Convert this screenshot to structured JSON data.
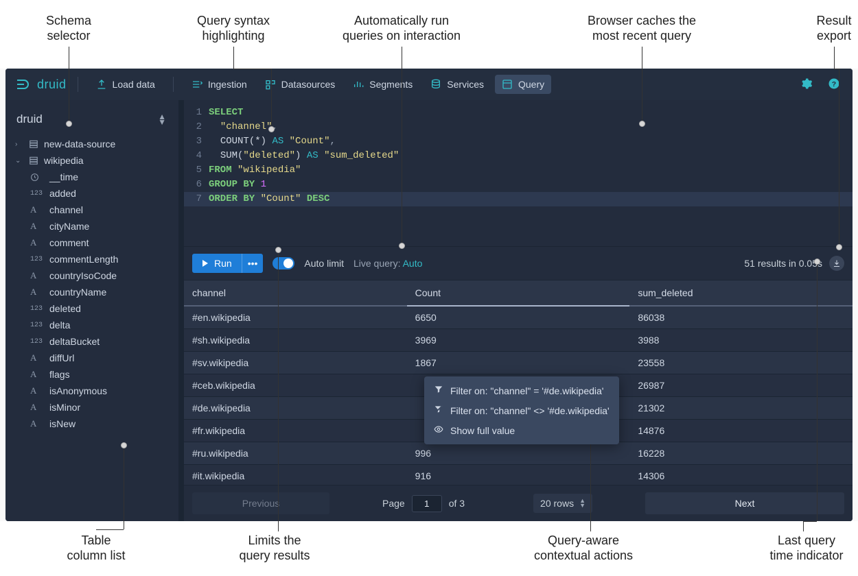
{
  "annotations": {
    "top": [
      "Schema\nselector",
      "Query syntax\nhighlighting",
      "Automatically run\nqueries on interaction",
      "Browser caches the\nmost recent query",
      "Result\nexport"
    ],
    "bottom": [
      "Table\ncolumn list",
      "Limits the\nquery results",
      "Query-aware\ncontextual actions",
      "Last query\ntime indicator"
    ]
  },
  "brand": "druid",
  "nav": {
    "load_data": "Load data",
    "ingestion": "Ingestion",
    "datasources": "Datasources",
    "segments": "Segments",
    "services": "Services",
    "query": "Query"
  },
  "sidebar": {
    "schema": "druid",
    "datasources": [
      {
        "name": "new-data-source",
        "expanded": false
      },
      {
        "name": "wikipedia",
        "expanded": true
      }
    ],
    "columns": [
      {
        "type": "time",
        "name": "__time"
      },
      {
        "type": "num",
        "name": "added"
      },
      {
        "type": "str",
        "name": "channel"
      },
      {
        "type": "str",
        "name": "cityName"
      },
      {
        "type": "str",
        "name": "comment"
      },
      {
        "type": "num",
        "name": "commentLength"
      },
      {
        "type": "str",
        "name": "countryIsoCode"
      },
      {
        "type": "str",
        "name": "countryName"
      },
      {
        "type": "num",
        "name": "deleted"
      },
      {
        "type": "num",
        "name": "delta"
      },
      {
        "type": "num",
        "name": "deltaBucket"
      },
      {
        "type": "str",
        "name": "diffUrl"
      },
      {
        "type": "str",
        "name": "flags"
      },
      {
        "type": "str",
        "name": "isAnonymous"
      },
      {
        "type": "str",
        "name": "isMinor"
      },
      {
        "type": "str",
        "name": "isNew"
      }
    ]
  },
  "editor": {
    "lines": [
      [
        [
          "kw",
          "SELECT"
        ]
      ],
      [
        [
          "pl",
          "  "
        ],
        [
          "str",
          "\"channel\""
        ],
        [
          "op",
          ","
        ]
      ],
      [
        [
          "pl",
          "  "
        ],
        [
          "fn",
          "COUNT(*) "
        ],
        [
          "as",
          "AS "
        ],
        [
          "str",
          "\"Count\""
        ],
        [
          "op",
          ","
        ]
      ],
      [
        [
          "pl",
          "  "
        ],
        [
          "fn",
          "SUM("
        ],
        [
          "str",
          "\"deleted\""
        ],
        [
          "fn",
          ") "
        ],
        [
          "as",
          "AS "
        ],
        [
          "str",
          "\"sum_deleted\""
        ]
      ],
      [
        [
          "kw",
          "FROM "
        ],
        [
          "str",
          "\"wikipedia\""
        ]
      ],
      [
        [
          "kw",
          "GROUP BY "
        ],
        [
          "num",
          "1"
        ]
      ],
      [
        [
          "kw",
          "ORDER BY "
        ],
        [
          "str",
          "\"Count\""
        ],
        [
          "kw",
          " DESC"
        ]
      ]
    ],
    "active_line": 7
  },
  "runbar": {
    "run": "Run",
    "auto_limit": "Auto limit",
    "live_query_label": "Live query: ",
    "live_query_value": "Auto",
    "status": "51 results in 0.05s"
  },
  "results": {
    "columns": [
      "channel",
      "Count",
      "sum_deleted"
    ],
    "sorted_col": "Count",
    "rows": [
      [
        "#en.wikipedia",
        "6650",
        "86038"
      ],
      [
        "#sh.wikipedia",
        "3969",
        " 3988"
      ],
      [
        "#sv.wikipedia",
        "1867",
        "23558"
      ],
      [
        "#ceb.wikipedia",
        "",
        "26987"
      ],
      [
        "#de.wikipedia",
        "",
        "21302"
      ],
      [
        "#fr.wikipedia",
        "",
        "14876"
      ],
      [
        "#ru.wikipedia",
        "996",
        "16228"
      ],
      [
        "#it.wikipedia",
        "916",
        "14306"
      ]
    ],
    "context_menu": [
      "Filter on: \"channel\" = '#de.wikipedia'",
      "Filter on: \"channel\" <> '#de.wikipedia'",
      "Show full value"
    ]
  },
  "pager": {
    "prev": "Previous",
    "next": "Next",
    "page_label": "Page",
    "page_value": "1",
    "page_of": "of 3",
    "rows": "20 rows"
  }
}
